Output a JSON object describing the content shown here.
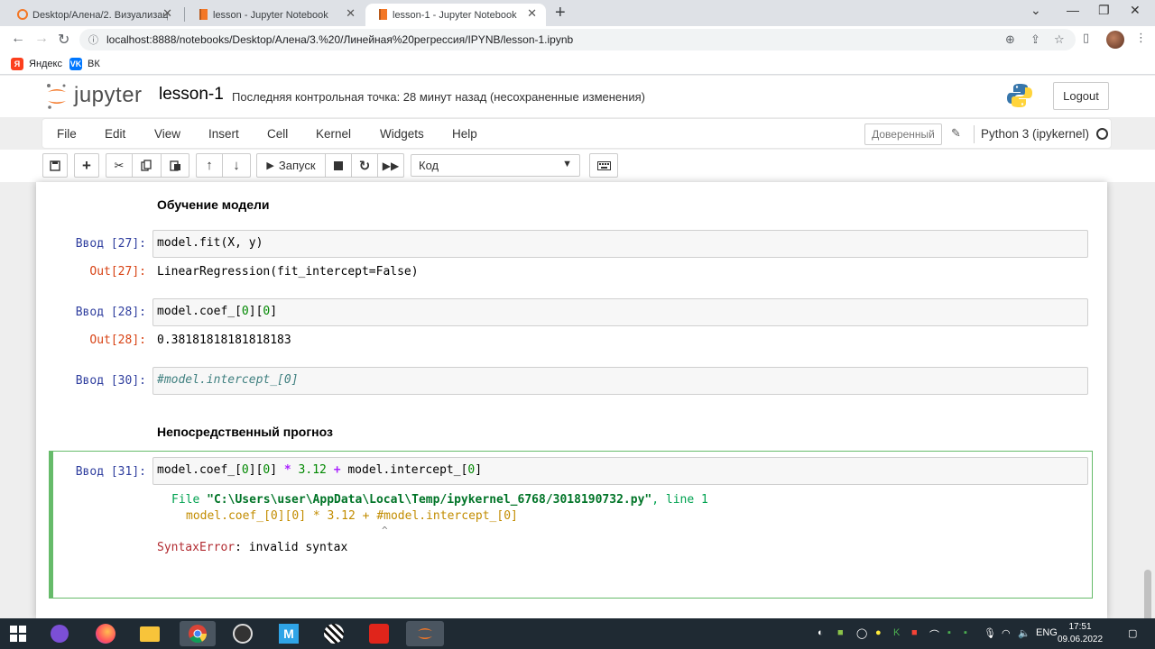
{
  "browser": {
    "tabs": [
      {
        "title": "Desktop/Алена/2. Визуализаци"
      },
      {
        "title": "lesson - Jupyter Notebook"
      },
      {
        "title": "lesson-1 - Jupyter Notebook"
      }
    ],
    "url": "localhost:8888/notebooks/Desktop/Алена/3.%20/Линейная%20регрессия/IPYNB/lesson-1.ipynb",
    "bookmarks": [
      {
        "label": "Яндекс",
        "icon": "yandex-icon"
      },
      {
        "label": "ВК",
        "icon": "vk-icon"
      }
    ]
  },
  "jupyter": {
    "logo_text": "jupyter",
    "notebook_name": "lesson-1",
    "checkpoint": "Последняя контрольная точка: 28 минут назад   (несохраненные изменения)",
    "logout": "Logout",
    "menu": [
      "File",
      "Edit",
      "View",
      "Insert",
      "Cell",
      "Kernel",
      "Widgets",
      "Help"
    ],
    "trusted": "Доверенный",
    "kernel": "Python 3 (ipykernel)",
    "run_label": "Запуск",
    "cell_type": "Код"
  },
  "cells": {
    "md1": "Обучение модели",
    "c27": {
      "prompt_in": "Ввод [27]:",
      "code": "model.fit(X, y)",
      "prompt_out": "Out[27]:",
      "output": "LinearRegression(fit_intercept=False)"
    },
    "c28": {
      "prompt_in": "Ввод [28]:",
      "code_a": "model.coef_[",
      "code_b": "0",
      "code_c": "][",
      "code_d": "0",
      "code_e": "]",
      "prompt_out": "Out[28]:",
      "output": "0.38181818181818183"
    },
    "c30": {
      "prompt_in": "Ввод [30]:",
      "code": "#model.intercept_[0]"
    },
    "md2": "Непосредственный прогноз",
    "c31": {
      "prompt_in": "Ввод [31]:",
      "code_a": "model.coef_[",
      "code_b": "0",
      "code_c": "][",
      "code_d": "0",
      "code_e": "] ",
      "code_f": "*",
      "code_g": " ",
      "code_h": "3.12",
      "code_i": " ",
      "code_j": "+",
      "code_k": " model.intercept_[",
      "code_l": "0",
      "code_m": "]",
      "tb_file_kw": "File",
      "tb_path": "\"C:\\Users\\user\\AppData\\Local\\Temp/ipykernel_6768/3018190732.py\"",
      "tb_line": ", line 1",
      "tb_code": "model.coef_[0][0] * 3.12 + #model.intercept_[0]",
      "tb_caret": "^",
      "err_name": "SyntaxError",
      "err_msg": ": invalid syntax"
    }
  },
  "taskbar": {
    "lang": "ENG",
    "time": "17:51",
    "date": "09.06.2022"
  }
}
